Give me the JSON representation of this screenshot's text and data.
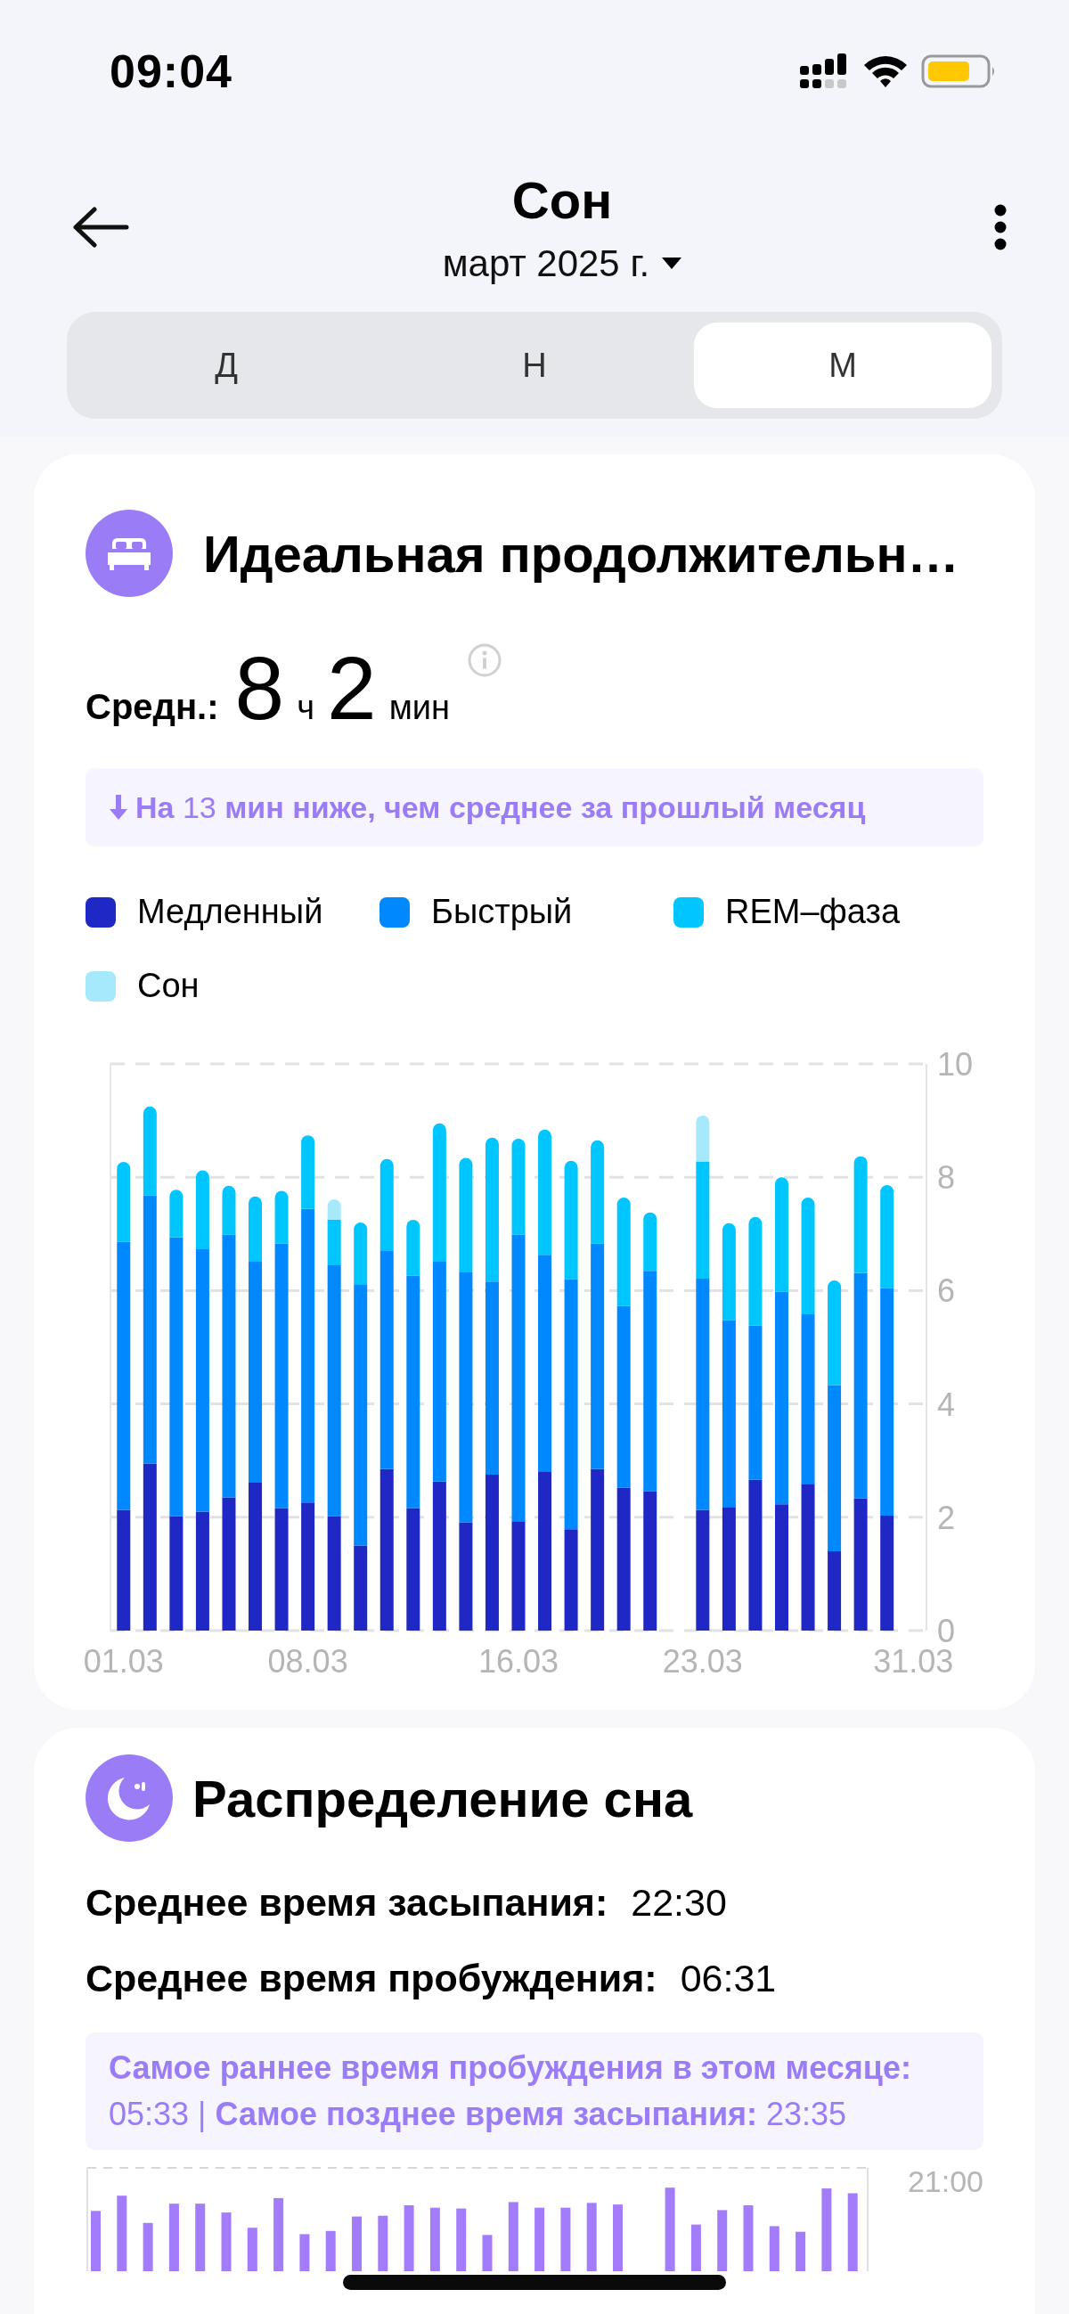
{
  "status_bar": {
    "time": "09:04"
  },
  "header": {
    "title": "Сон",
    "period": "март 2025 г."
  },
  "tabs": [
    {
      "label": "Д",
      "selected": false
    },
    {
      "label": "Н",
      "selected": false
    },
    {
      "label": "М",
      "selected": true
    }
  ],
  "duration_card": {
    "title": "Идеальная продолжительн…",
    "average_label": "Средн.:",
    "hours": "8",
    "hours_unit": "ч",
    "minutes": "2",
    "minutes_unit": "мин",
    "comparison": "**На** 13 **мин ниже, чем среднее за прошлый месяц**",
    "chart_data": {
      "type": "bar",
      "stacked": true,
      "grid": true,
      "categories": [
        "01.03",
        null,
        null,
        null,
        null,
        null,
        null,
        "08.03",
        null,
        null,
        null,
        null,
        null,
        null,
        null,
        "16.03",
        null,
        null,
        null,
        null,
        null,
        null,
        "23.03",
        null,
        null,
        null,
        null,
        null,
        null,
        null,
        "31.03"
      ],
      "ylim": [
        0,
        10
      ],
      "yticks": [
        0,
        2,
        4,
        6,
        8,
        10
      ],
      "series": [
        {
          "name": "Медленный",
          "color": "#1f27c4",
          "values": [
            2.13,
            2.95,
            2.02,
            2.1,
            2.35,
            2.61,
            2.16,
            2.26,
            2.02,
            1.5,
            2.85,
            2.16,
            2.63,
            1.91,
            2.75,
            1.93,
            2.81,
            1.79,
            2.85,
            2.52,
            2.46,
            null,
            2.13,
            2.18,
            2.66,
            2.23,
            2.59,
            1.4,
            2.33,
            2.03,
            null
          ]
        },
        {
          "name": "Быстрый",
          "color": "#0088ff",
          "values": [
            4.73,
            4.73,
            4.92,
            4.63,
            4.64,
            3.9,
            4.67,
            5.18,
            4.44,
            4.6,
            3.86,
            4.1,
            3.88,
            4.41,
            3.41,
            5.06,
            3.82,
            4.41,
            3.98,
            3.21,
            3.89,
            null,
            4.08,
            3.3,
            2.72,
            3.75,
            2.99,
            2.93,
            3.98,
            4.01,
            null
          ]
        },
        {
          "name": "REM–фаза",
          "color": "#00c6ff",
          "values": [
            1.41,
            1.57,
            0.84,
            1.39,
            0.86,
            1.15,
            0.93,
            1.3,
            0.79,
            1.1,
            1.61,
            0.99,
            2.44,
            2.02,
            2.54,
            1.69,
            2.21,
            2.09,
            1.82,
            1.91,
            1.03,
            null,
            2.07,
            1.71,
            1.92,
            2.02,
            2.06,
            1.85,
            2.06,
            1.82,
            null
          ]
        },
        {
          "name": "Сон",
          "color": "#a6e9fd",
          "values": [
            0,
            0,
            0,
            0,
            0,
            0,
            0,
            0,
            0.36,
            0,
            0,
            0,
            0,
            0,
            0,
            0,
            0,
            0,
            0,
            0,
            0,
            null,
            0.81,
            0,
            0,
            0,
            0,
            0,
            0,
            0,
            null
          ]
        }
      ]
    }
  },
  "distribution_card": {
    "title": "Распределение сна",
    "rows": [
      {
        "label": "Среднее время засыпания:",
        "value": "22:30"
      },
      {
        "label": "Среднее время пробуждения:",
        "value": "06:31"
      }
    ],
    "note": "**Самое раннее время пробуждения в этом месяце:** 05:33 | **Самое позднее время засыпания:** 23:35",
    "chart_tick": "21:00"
  }
}
